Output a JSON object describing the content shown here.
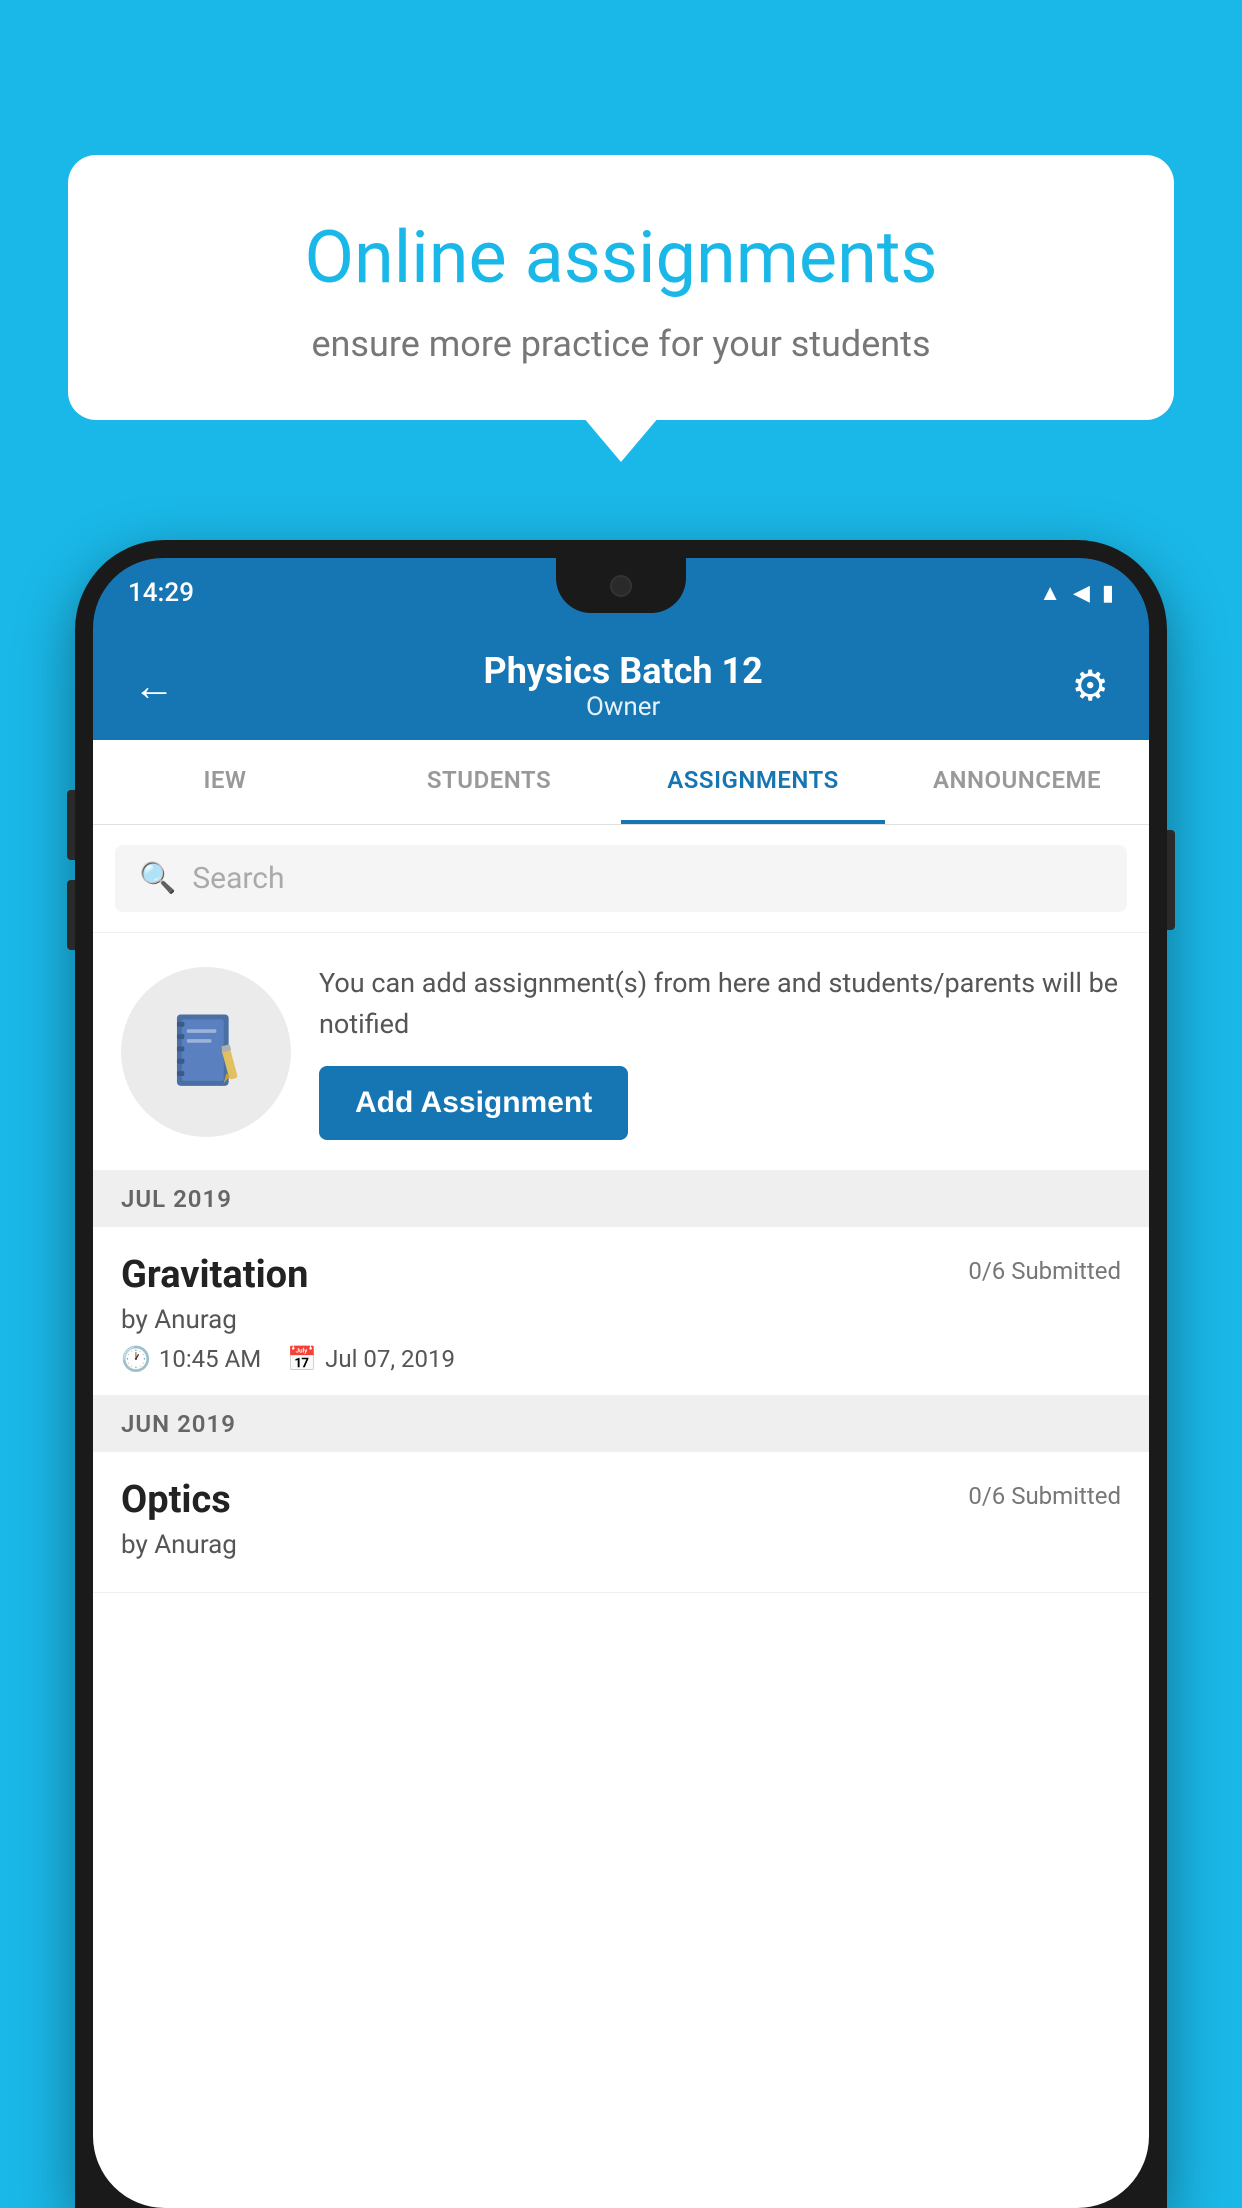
{
  "background": {
    "color": "#1ab8e8"
  },
  "speech_bubble": {
    "title": "Online assignments",
    "subtitle": "ensure more practice for your students"
  },
  "status_bar": {
    "time": "14:29",
    "wifi": "▲",
    "signal": "▲",
    "battery": "▮"
  },
  "app_header": {
    "back_label": "←",
    "title": "Physics Batch 12",
    "subtitle": "Owner",
    "gear_label": "⚙"
  },
  "tabs": [
    {
      "label": "IEW",
      "active": false
    },
    {
      "label": "STUDENTS",
      "active": false
    },
    {
      "label": "ASSIGNMENTS",
      "active": true
    },
    {
      "label": "ANNOUNCEME",
      "active": false
    }
  ],
  "search": {
    "placeholder": "Search"
  },
  "promo": {
    "text": "You can add assignment(s) from here and students/parents will be notified",
    "button_label": "Add Assignment"
  },
  "months": [
    {
      "label": "JUL 2019",
      "assignments": [
        {
          "name": "Gravitation",
          "submitted": "0/6 Submitted",
          "author": "by Anurag",
          "time": "10:45 AM",
          "date": "Jul 07, 2019"
        }
      ]
    },
    {
      "label": "JUN 2019",
      "assignments": [
        {
          "name": "Optics",
          "submitted": "0/6 Submitted",
          "author": "by Anurag",
          "time": "",
          "date": ""
        }
      ]
    }
  ]
}
